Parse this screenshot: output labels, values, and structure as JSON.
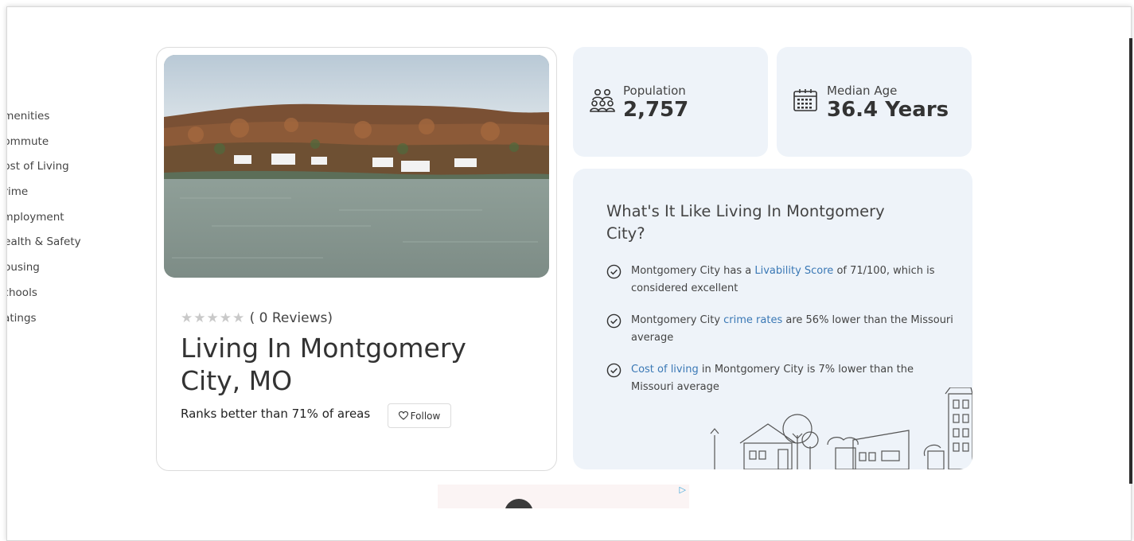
{
  "sidebar": {
    "items": [
      "Amenities",
      "Commute",
      "Cost of Living",
      "Crime",
      "Employment",
      "Health & Safety",
      "Housing",
      "Schools",
      "Ratings"
    ]
  },
  "hero": {
    "stars": "★★★★★",
    "reviews_text": "( 0 Reviews)",
    "title": "Living In Montgomery City, MO",
    "rank_text": "Ranks better than 71% of areas",
    "follow_label": "Follow"
  },
  "stats": {
    "population": {
      "label": "Population",
      "value": "2,757",
      "icon": "people-icon"
    },
    "median_age": {
      "label": "Median Age",
      "value": "36.4 Years",
      "icon": "calendar-icon"
    }
  },
  "living": {
    "title": "What's It Like Living In Montgomery City?",
    "facts": [
      {
        "pre": "Montgomery City has a ",
        "link": "Livability Score",
        "post": " of 71/100, which is considered excellent"
      },
      {
        "pre": "Montgomery City ",
        "link": "crime rates",
        "post": " are 56% lower than the Missouri average"
      },
      {
        "pre": "",
        "link": "Cost of living",
        "post": " in Montgomery City is 7% lower than the Missouri average"
      }
    ]
  },
  "colors": {
    "card_bg": "#eef3f9",
    "link": "#3a78b5",
    "text": "#333333"
  }
}
